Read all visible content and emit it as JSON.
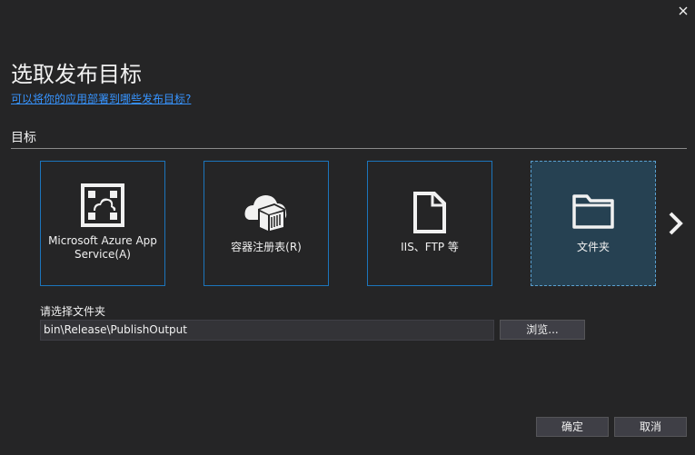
{
  "dialog": {
    "title": "选取发布目标",
    "help_link": "可以将你的应用部署到哪些发布目标?",
    "section_label": "目标"
  },
  "targets": [
    {
      "label": "Microsoft Azure App Service(A)",
      "icon": "azure-app-service-icon"
    },
    {
      "label": "容器注册表(R)",
      "icon": "container-registry-icon"
    },
    {
      "label": "IIS、FTP 等",
      "icon": "document-icon"
    },
    {
      "label": "文件夹",
      "icon": "folder-icon",
      "selected": true
    }
  ],
  "folder": {
    "label": "请选择文件夹",
    "value": "bin\\Release\\PublishOutput",
    "browse_label": "浏览..."
  },
  "buttons": {
    "ok": "确定",
    "cancel": "取消"
  },
  "colors": {
    "background": "#252526",
    "accent_border": "#1c75bc",
    "selected_tile": "#264152",
    "link": "#3794ff"
  }
}
